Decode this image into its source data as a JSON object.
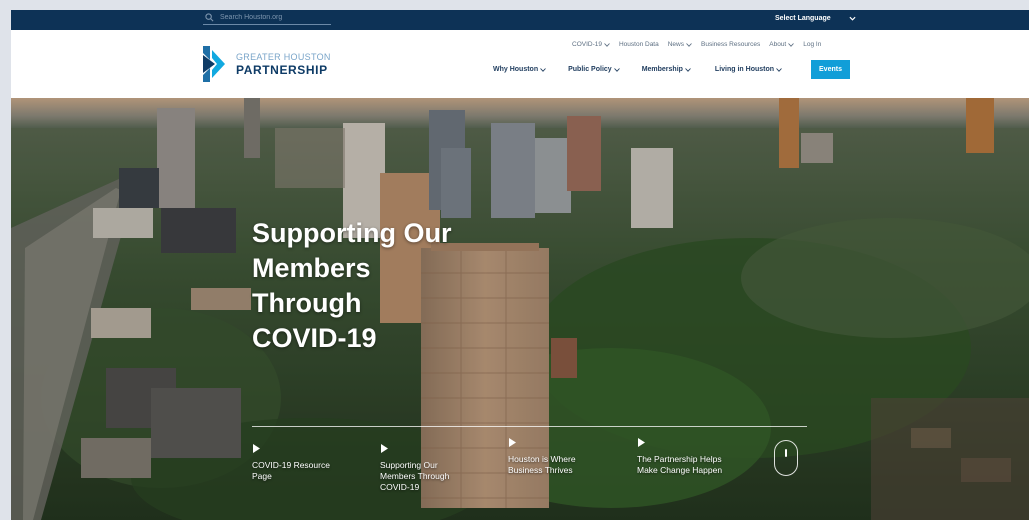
{
  "utility_bar": {
    "search_placeholder": "Search Houston.org",
    "language_label": "Select Language"
  },
  "logo": {
    "line1": "GREATER HOUSTON",
    "line2": "PARTNERSHIP"
  },
  "utility_nav": [
    {
      "label": "COVID-19",
      "dropdown": true
    },
    {
      "label": "Houston Data",
      "dropdown": false
    },
    {
      "label": "News",
      "dropdown": true
    },
    {
      "label": "Business Resources",
      "dropdown": false
    },
    {
      "label": "About",
      "dropdown": true
    },
    {
      "label": "Log In",
      "dropdown": false
    }
  ],
  "main_nav": [
    {
      "label": "Why Houston"
    },
    {
      "label": "Public Policy"
    },
    {
      "label": "Membership"
    },
    {
      "label": "Living in Houston"
    }
  ],
  "events_button": "Events",
  "hero": {
    "headline_lines": [
      "Supporting Our",
      "Members",
      "Through",
      "COVID-19"
    ],
    "quick_links": [
      {
        "lines": [
          "COVID-19 Resource",
          "Page"
        ]
      },
      {
        "lines": [
          "Supporting Our",
          "Members Through",
          "COVID-19"
        ]
      },
      {
        "lines": [
          "Houston is Where",
          "Business Thrives"
        ]
      },
      {
        "lines": [
          "The Partnership Helps",
          "Make Change Happen"
        ]
      }
    ]
  },
  "colors": {
    "utility_bar_bg": "#0d3256",
    "brand_navy": "#0e3b66",
    "brand_light_blue": "#7aa5c9",
    "events_button_bg": "#119ed8"
  },
  "icons": [
    "search-icon",
    "chevron-down-icon",
    "chevron-right-icon",
    "scroll-mouse-icon"
  ]
}
